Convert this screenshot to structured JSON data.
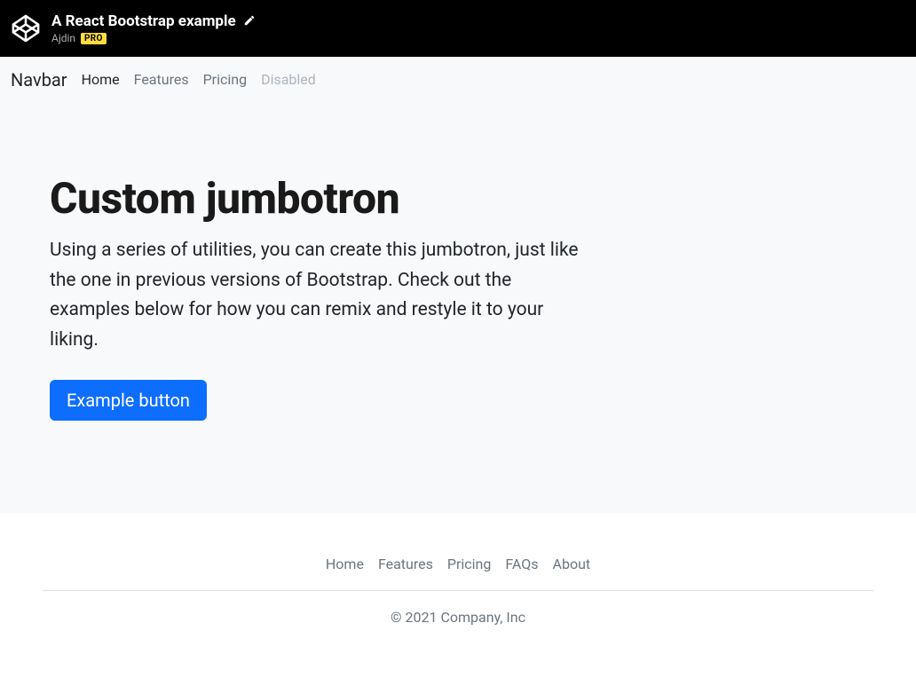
{
  "codepen": {
    "title": "A React Bootstrap example",
    "author": "Ajdin",
    "badge": "PRO"
  },
  "navbar": {
    "brand": "Navbar",
    "items": [
      {
        "label": "Home",
        "state": "active"
      },
      {
        "label": "Features",
        "state": "normal"
      },
      {
        "label": "Pricing",
        "state": "normal"
      },
      {
        "label": "Disabled",
        "state": "disabled"
      }
    ]
  },
  "jumbotron": {
    "heading": "Custom jumbotron",
    "body": "Using a series of utilities, you can create this jumbotron, just like the one in previous versions of Bootstrap. Check out the examples below for how you can remix and restyle it to your liking.",
    "button": "Example button"
  },
  "footer": {
    "links": [
      "Home",
      "Features",
      "Pricing",
      "FAQs",
      "About"
    ],
    "copyright": "© 2021 Company, Inc"
  }
}
